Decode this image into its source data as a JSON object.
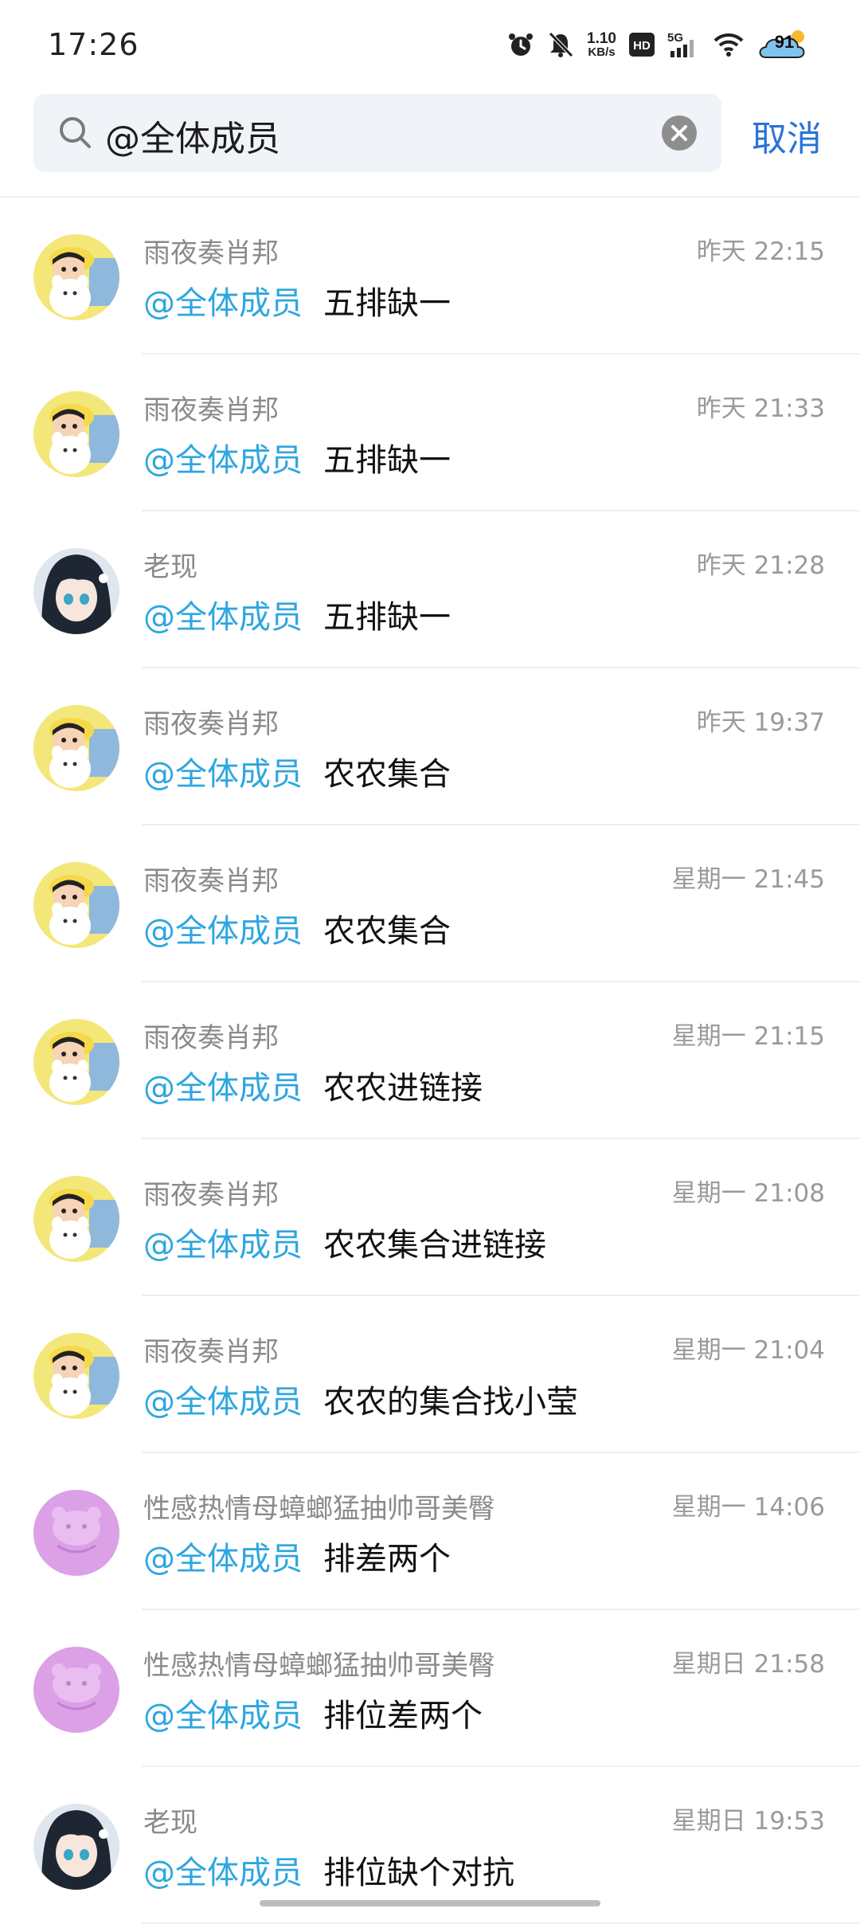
{
  "status_bar": {
    "time": "17:26",
    "net_speed_value": "1.10",
    "net_speed_unit": "KB/s",
    "hd_label": "HD",
    "network_label": "5G",
    "weather_temp": "91",
    "icons": [
      "alarm-icon",
      "mute-icon",
      "hd-icon",
      "signal-icon",
      "wifi-icon",
      "weather-icon"
    ]
  },
  "search": {
    "query": "@全体成员",
    "cancel_label": "取消"
  },
  "accent_color": "#2ea6e0",
  "results": [
    {
      "sender": "雨夜奏肖邦",
      "time": "昨天 22:15",
      "mention": "@全体成员",
      "text": "五排缺一",
      "avatar": "shinchan"
    },
    {
      "sender": "雨夜奏肖邦",
      "time": "昨天 21:33",
      "mention": "@全体成员",
      "text": "五排缺一",
      "avatar": "shinchan"
    },
    {
      "sender": "老现",
      "time": "昨天 21:28",
      "mention": "@全体成员",
      "text": "五排缺一",
      "avatar": "anime"
    },
    {
      "sender": "雨夜奏肖邦",
      "time": "昨天 19:37",
      "mention": "@全体成员",
      "text": "农农集合",
      "avatar": "shinchan"
    },
    {
      "sender": "雨夜奏肖邦",
      "time": "星期一 21:45",
      "mention": "@全体成员",
      "text": "农农集合",
      "avatar": "shinchan"
    },
    {
      "sender": "雨夜奏肖邦",
      "time": "星期一 21:15",
      "mention": "@全体成员",
      "text": "农农进链接",
      "avatar": "shinchan"
    },
    {
      "sender": "雨夜奏肖邦",
      "time": "星期一 21:08",
      "mention": "@全体成员",
      "text": "农农集合进链接",
      "avatar": "shinchan"
    },
    {
      "sender": "雨夜奏肖邦",
      "time": "星期一 21:04",
      "mention": "@全体成员",
      "text": "农农的集合找小莹",
      "avatar": "shinchan"
    },
    {
      "sender": "性感热情母蟑螂猛抽帅哥美臀",
      "time": "星期一 14:06",
      "mention": "@全体成员",
      "text": "排差两个",
      "avatar": "deactivated"
    },
    {
      "sender": "性感热情母蟑螂猛抽帅哥美臀",
      "time": "星期日 21:58",
      "mention": "@全体成员",
      "text": "排位差两个",
      "avatar": "deactivated"
    },
    {
      "sender": "老现",
      "time": "星期日 19:53",
      "mention": "@全体成员",
      "text": "排位缺个对抗",
      "avatar": "anime"
    }
  ]
}
